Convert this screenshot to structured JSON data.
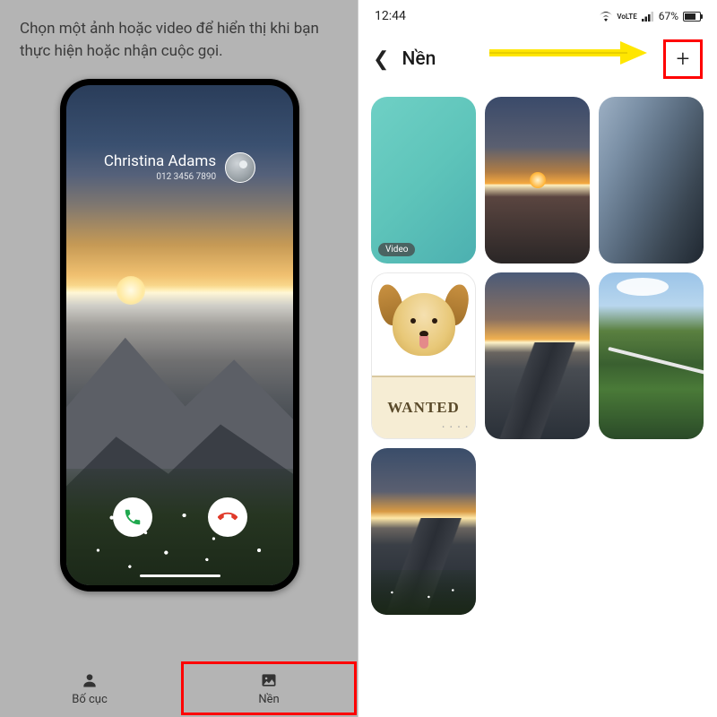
{
  "left": {
    "instruction": "Chọn một ảnh hoặc video để hiển thị khi bạn thực hiện hoặc nhận cuộc gọi.",
    "caller_name": "Christina Adams",
    "caller_number": "012 3456 7890",
    "tabs": {
      "layout": "Bố cục",
      "background": "Nền"
    }
  },
  "right": {
    "statusbar": {
      "time": "12:44",
      "battery": "67%"
    },
    "header_title": "Nền",
    "video_badge": "Video",
    "wanted": "WANTED"
  }
}
